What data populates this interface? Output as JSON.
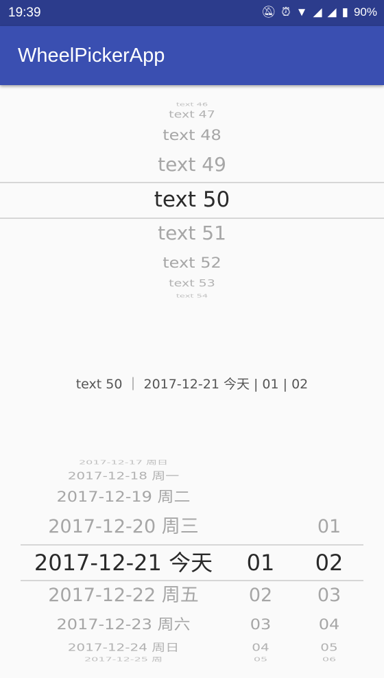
{
  "status_bar": {
    "time": "19:39",
    "battery": "90%",
    "icons": [
      "bell-off-icon",
      "alarm-icon",
      "wifi-icon",
      "signal-icon",
      "signal-icon",
      "battery-icon"
    ]
  },
  "app_bar": {
    "title": "WheelPickerApp"
  },
  "text_wheel": {
    "items": [
      "text 46",
      "text 47",
      "text 48",
      "text 49",
      "text 50",
      "text 51",
      "text 52",
      "text 53",
      "text 54"
    ],
    "selected": "text 50"
  },
  "summary": "text 50 ｜ 2017-12-21 今天 | 01 | 02",
  "date_wheel": {
    "items": [
      "2017-12-17 周日",
      "2017-12-18 周一",
      "2017-12-19 周二",
      "2017-12-20 周三",
      "2017-12-21 今天",
      "2017-12-22 周五",
      "2017-12-23 周六",
      "2017-12-24 周日",
      "2017-12-25 周"
    ],
    "selected": "2017-12-21 今天"
  },
  "hour_wheel": {
    "items": [
      "",
      "",
      "",
      "",
      "01",
      "02",
      "03",
      "04",
      "05"
    ],
    "selected": "01"
  },
  "minute_wheel": {
    "items": [
      "",
      "",
      "",
      "01",
      "02",
      "03",
      "04",
      "05",
      "06"
    ],
    "selected": "02"
  },
  "colors": {
    "status_bar": "#2c3c8c",
    "app_bar": "#3a4fb1",
    "selected_text": "#2a2a2a",
    "unselected_text": "#a6a6a6"
  }
}
